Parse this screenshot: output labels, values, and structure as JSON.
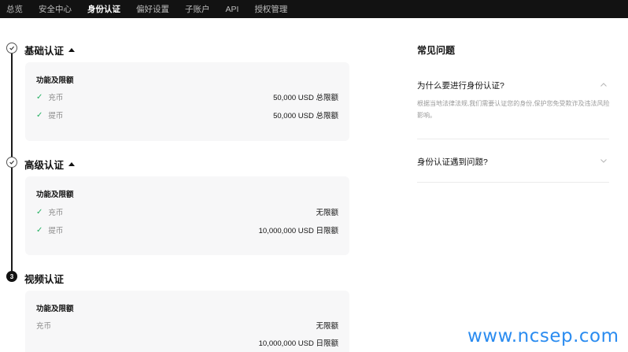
{
  "nav": {
    "tabs": [
      {
        "label": "总览",
        "active": false
      },
      {
        "label": "安全中心",
        "active": false
      },
      {
        "label": "身份认证",
        "active": true
      },
      {
        "label": "偏好设置",
        "active": false
      },
      {
        "label": "子账户",
        "active": false
      },
      {
        "label": "API",
        "active": false
      },
      {
        "label": "授权管理",
        "active": false
      }
    ]
  },
  "steps": [
    {
      "title": "基础认证",
      "status": "done",
      "card": {
        "heading": "功能及限额",
        "rows": [
          {
            "label": "充币",
            "value": "50,000 USD 总限额"
          },
          {
            "label": "提币",
            "value": "50,000 USD 总限额"
          }
        ]
      }
    },
    {
      "title": "高级认证",
      "status": "done",
      "card": {
        "heading": "功能及限额",
        "rows": [
          {
            "label": "充币",
            "value": "无限额"
          },
          {
            "label": "提币",
            "value": "10,000,000 USD 日限额"
          }
        ]
      }
    },
    {
      "title": "视频认证",
      "status": "pending",
      "number": "3",
      "card": {
        "heading": "功能及限额",
        "rows": [
          {
            "label": "充币",
            "value": "无限额"
          },
          {
            "label": "",
            "value": "10,000,000 USD 日限额"
          }
        ]
      }
    }
  ],
  "faq": {
    "title": "常见问题",
    "items": [
      {
        "question": "为什么要进行身份认证?",
        "answer": "根据当地法律法规,我们需要认证您的身份,保护您免受欺诈及违法风险影响。",
        "expanded": true
      },
      {
        "question": "身份认证遇到问题?",
        "expanded": false
      }
    ]
  },
  "watermark": "www.ncsep.com",
  "colors": {
    "nav_bg": "#121212",
    "check": "#22b061",
    "card_bg": "#f7f7f8",
    "watermark": "#2b8cf0"
  },
  "icons": {
    "done": "check-circle-icon",
    "expand": "chevron-up-icon",
    "collapse": "chevron-down-icon",
    "check": "check-icon"
  }
}
